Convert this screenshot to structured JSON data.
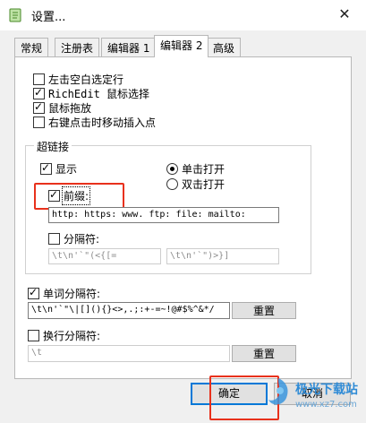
{
  "window": {
    "title": "设置..."
  },
  "tabs": [
    {
      "label": "常规",
      "active": false
    },
    {
      "label": "注册表",
      "active": false
    },
    {
      "label": "编辑器 1",
      "active": false
    },
    {
      "label": "编辑器 2",
      "active": true
    },
    {
      "label": "高级",
      "active": false
    }
  ],
  "options": [
    {
      "label": "左击空白选定行",
      "checked": false
    },
    {
      "label": "RichEdit 鼠标选择",
      "checked": true
    },
    {
      "label": "鼠标拖放",
      "checked": true
    },
    {
      "label": "右键点击时移动插入点",
      "checked": false
    }
  ],
  "hyperlink": {
    "group_label": "超链接",
    "show_label": "显示",
    "show_checked": true,
    "single_click": "单击打开",
    "double_click": "双击打开",
    "prefix_label": "前缀:",
    "prefix_checked": true,
    "prefix_value": "http: https: www. ftp: file: mailto:",
    "separator_label": "分隔符:",
    "separator_checked": false,
    "separator_left": "\\t\\n'`\"(<{[=",
    "separator_right": "\\t\\n'`\")>}]"
  },
  "word_separator": {
    "label": "单词分隔符:",
    "checked": true,
    "value": "\\t\\n'`\"\\|[](){}<>,.;:+-=~!@#$%^&*/",
    "reset_label": "重置"
  },
  "line_separator": {
    "label": "换行分隔符:",
    "checked": false,
    "value": "\\t",
    "reset_label": "重置"
  },
  "buttons": {
    "ok": "确定",
    "cancel": "取消"
  },
  "watermark": {
    "text": "极光下载站",
    "url": "www.xz7.com"
  },
  "colors": {
    "accent": "#0078d7",
    "highlight": "#e8311c"
  }
}
